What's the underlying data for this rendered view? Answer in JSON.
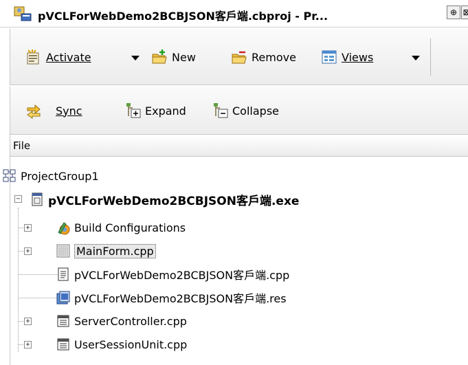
{
  "window": {
    "title": "pVCLForWebDemo2BCBJSON客戶端.cbproj - Pr...",
    "pin_glyph": "⊕",
    "close_glyph": "⊠",
    "app_icon": "project-manager-icon"
  },
  "toolbar1": {
    "activate": "Activate",
    "new": "New",
    "remove": "Remove",
    "views": "Views"
  },
  "toolbar2": {
    "sync": "Sync",
    "expand": "Expand",
    "collapse": "Collapse"
  },
  "tree": {
    "header": "File",
    "root": "ProjectGroup1",
    "project": "pVCLForWebDemo2BCBJSON客戶端.exe",
    "items": [
      {
        "label": "Build Configurations",
        "icon": "build-config-icon",
        "expander": "+"
      },
      {
        "label": "MainForm.cpp",
        "icon": "form-icon",
        "expander": "+",
        "selected": true
      },
      {
        "label": "pVCLForWebDemo2BCBJSON客戶端.cpp",
        "icon": "cpp-file-icon"
      },
      {
        "label": "pVCLForWebDemo2BCBJSON客戶端.res",
        "icon": "res-file-icon"
      },
      {
        "label": "ServerController.cpp",
        "icon": "unit-icon",
        "expander": "+"
      },
      {
        "label": "UserSessionUnit.cpp",
        "icon": "unit-icon",
        "expander": "+"
      }
    ]
  },
  "colors": {
    "toolbar_bg": "#f2f2f2",
    "selection": "#e8e8e8"
  }
}
